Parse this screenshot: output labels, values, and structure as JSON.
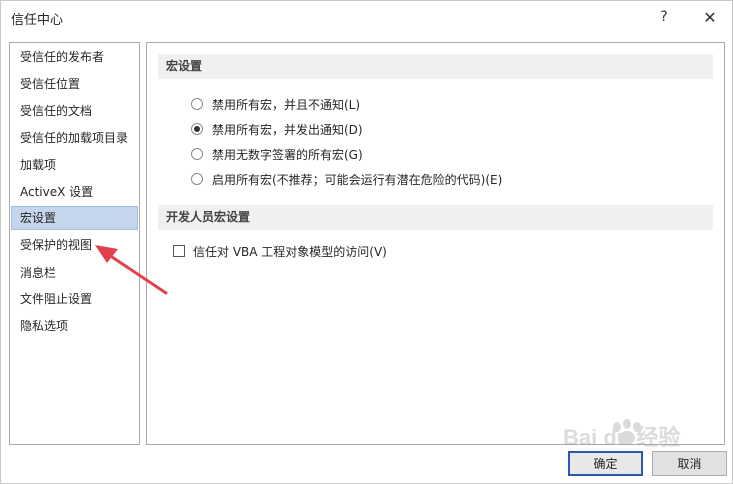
{
  "window": {
    "title": "信任中心",
    "help_label": "?",
    "close_label": "✕"
  },
  "sidebar": {
    "items": [
      {
        "label": "受信任的发布者",
        "selected": false
      },
      {
        "label": "受信任位置",
        "selected": false
      },
      {
        "label": "受信任的文档",
        "selected": false
      },
      {
        "label": "受信任的加载项目录",
        "selected": false
      },
      {
        "label": "加载项",
        "selected": false
      },
      {
        "label": "ActiveX 设置",
        "selected": false
      },
      {
        "label": "宏设置",
        "selected": true
      },
      {
        "label": "受保护的视图",
        "selected": false
      },
      {
        "label": "消息栏",
        "selected": false
      },
      {
        "label": "文件阻止设置",
        "selected": false
      },
      {
        "label": "隐私选项",
        "selected": false
      }
    ]
  },
  "macro_settings": {
    "header": "宏设置",
    "options": [
      {
        "label": "禁用所有宏，并且不通知(L)",
        "checked": false
      },
      {
        "label": "禁用所有宏，并发出通知(D)",
        "checked": true
      },
      {
        "label": "禁用无数字签署的所有宏(G)",
        "checked": false
      },
      {
        "label": "启用所有宏(不推荐；可能会运行有潜在危险的代码)(E)",
        "checked": false
      }
    ]
  },
  "developer_settings": {
    "header": "开发人员宏设置",
    "vba_access_label": "信任对 VBA 工程对象模型的访问(V)",
    "vba_access_checked": false
  },
  "buttons": {
    "ok_label": "确定",
    "cancel_label": "取消"
  },
  "watermark": {
    "text": "Bai du 经验"
  },
  "colors": {
    "selected_bg": "#c5d5ec",
    "section_header_bg": "#f0f0f0",
    "ok_border": "#2a5aa8",
    "annotation_arrow": "#e0414b"
  }
}
